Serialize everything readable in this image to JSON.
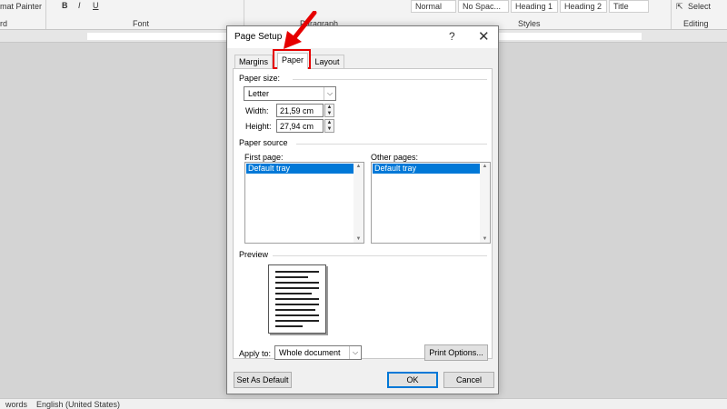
{
  "ribbon": {
    "format_painter": "mat Painter",
    "bold": "B",
    "italic": "I",
    "underline": "U",
    "clipboard_group": "rd",
    "font_group": "Font",
    "paragraph_group": "Paragraph",
    "styles_group": "Styles",
    "editing_group": "Editing",
    "styles": [
      "Normal",
      "No Spac...",
      "Heading 1",
      "Heading 2",
      "Title"
    ],
    "select_label": "Select"
  },
  "statusbar": {
    "words": "words",
    "language": "English (United States)"
  },
  "dialog": {
    "title": "Page Setup",
    "help": "?",
    "close": "✕",
    "tabs": [
      {
        "label": "Margins"
      },
      {
        "label": "Paper"
      },
      {
        "label": "Layout"
      }
    ],
    "active_tab": "Paper",
    "paper_size": {
      "section_label": "Paper size:",
      "selected": "Letter",
      "width_label": "Width:",
      "width_value": "21,59 cm",
      "height_label": "Height:",
      "height_value": "27,94 cm"
    },
    "paper_source": {
      "section_label": "Paper source",
      "first_page_label": "First page:",
      "first_page_items": [
        "Default tray"
      ],
      "other_pages_label": "Other pages:",
      "other_pages_items": [
        "Default tray"
      ]
    },
    "preview": {
      "section_label": "Preview",
      "apply_to_label": "Apply to:",
      "apply_to_value": "Whole document",
      "print_options_label": "Print Options..."
    },
    "buttons": {
      "set_default": "Set As Default",
      "ok": "OK",
      "cancel": "Cancel"
    }
  },
  "annotation": {
    "highlight_color": "#e60000"
  }
}
